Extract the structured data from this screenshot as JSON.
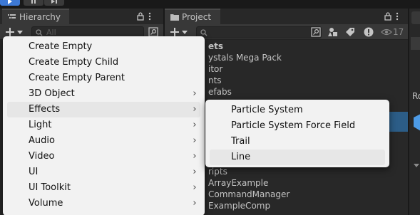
{
  "hierarchy": {
    "tab_label": "Hierarchy",
    "search_placeholder": "All"
  },
  "project": {
    "tab_label": "Project",
    "hidden_count": "17",
    "rows": [
      "ets",
      "ystals Mega Pack",
      "itor",
      "nts",
      "efabs",
      "ripts",
      "ArrayExample",
      "CommandManager",
      "ExampleComp"
    ]
  },
  "inspector": {
    "label": "Ro"
  },
  "context_menu": {
    "items": [
      {
        "label": "Create Empty",
        "submenu": false
      },
      {
        "label": "Create Empty Child",
        "submenu": false
      },
      {
        "label": "Create Empty Parent",
        "submenu": false
      },
      {
        "label": "3D Object",
        "submenu": true
      },
      {
        "label": "Effects",
        "submenu": true
      },
      {
        "label": "Light",
        "submenu": true
      },
      {
        "label": "Audio",
        "submenu": true
      },
      {
        "label": "Video",
        "submenu": true
      },
      {
        "label": "UI",
        "submenu": true
      },
      {
        "label": "UI Toolkit",
        "submenu": true
      },
      {
        "label": "Volume",
        "submenu": true
      }
    ],
    "highlighted": "Effects",
    "arrow_glyph": "›"
  },
  "effects_submenu": {
    "items": [
      "Particle System",
      "Particle System Force Field",
      "Trail",
      "Line"
    ],
    "highlighted": "Line"
  },
  "colors": {
    "accent": "#3d79d6",
    "panel_bg": "#282828",
    "menu_bg": "#f2f2f2",
    "selection": "#2c5d87"
  },
  "icons": [
    "play-icon",
    "pause-icon",
    "step-icon",
    "hierarchy-list-icon",
    "folder-icon",
    "lock-icon",
    "kebab-menu-icon",
    "plus-icon",
    "chevron-down-icon",
    "search-icon",
    "scene-search-icon",
    "filter-by-type-icon",
    "filter-by-label-icon",
    "warning-icon",
    "eye-icon"
  ]
}
